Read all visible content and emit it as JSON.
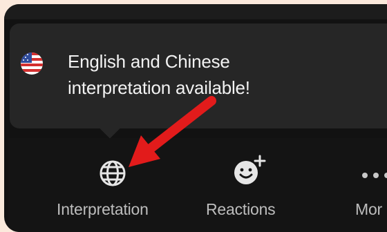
{
  "notification": {
    "line1": "English and Chinese",
    "line2": "interpretation available!",
    "flag_icon": "us-flag-icon"
  },
  "toolbar": {
    "items": [
      {
        "label": "Interpretation",
        "icon": "globe-icon"
      },
      {
        "label": "Reactions",
        "icon": "smiley-plus-icon"
      },
      {
        "label": "Mor",
        "icon": "ellipsis-icon"
      }
    ]
  },
  "annotation": {
    "arrow_color": "#e21b1b",
    "icon": "red-arrow-icon"
  },
  "colors": {
    "background": "#121212",
    "tooltip": "#262626",
    "text": "#f2f2f2",
    "label": "#bdbdbd",
    "arrow": "#e21b1b"
  }
}
